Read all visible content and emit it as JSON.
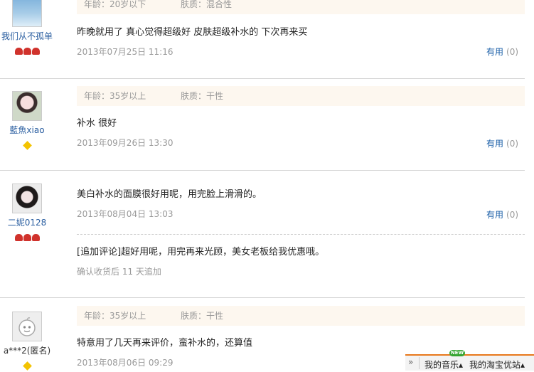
{
  "reviews": [
    {
      "username": "我们从不孤单",
      "age": "年龄：20岁以下",
      "skin": "肤质：混合性",
      "content": "昨晚就用了 真心觉得超级好 皮肤超级补水的 下次再来买",
      "date": "2013年07月25日 11:16",
      "useful_label": "有用",
      "useful_count": "(0)",
      "badge": "hearts",
      "badge_count": 3
    },
    {
      "username": "藍魚xiao",
      "age": "年龄：35岁以上",
      "skin": "肤质：干性",
      "content": "补水 很好",
      "date": "2013年09月26日 13:30",
      "useful_label": "有用",
      "useful_count": "(0)",
      "badge": "diamond",
      "badge_count": 1
    },
    {
      "username": "二妮0128",
      "content": "美白补水的面膜很好用呢，用完脸上滑滑的。",
      "date": "2013年08月04日 13:03",
      "useful_label": "有用",
      "useful_count": "(0)",
      "append_comment": "[追加评论]超好用呢，用完再来光顾，美女老板给我优惠哦。",
      "append_note": "确认收货后 11 天追加",
      "badge": "hearts",
      "badge_count": 3
    },
    {
      "username": "a***2(匿名)",
      "age": "年龄：35岁以上",
      "skin": "肤质：干性",
      "content": "特意用了几天再来评价，蛮补水的，还算值",
      "date": "2013年08月06日 09:29",
      "badge": "diamond",
      "badge_count": 1
    }
  ],
  "toolbar": {
    "arrows": "»",
    "my_music": "我的音乐▴",
    "my_taobao": "我的淘宝优站▴",
    "new_badge": "NEW"
  },
  "colors": {
    "meta_bg": "#fdf7ef",
    "link": "#1b5fa8",
    "heart": "#d0322c",
    "diamond": "#f3c300",
    "toolbar_accent": "#e8781b"
  }
}
